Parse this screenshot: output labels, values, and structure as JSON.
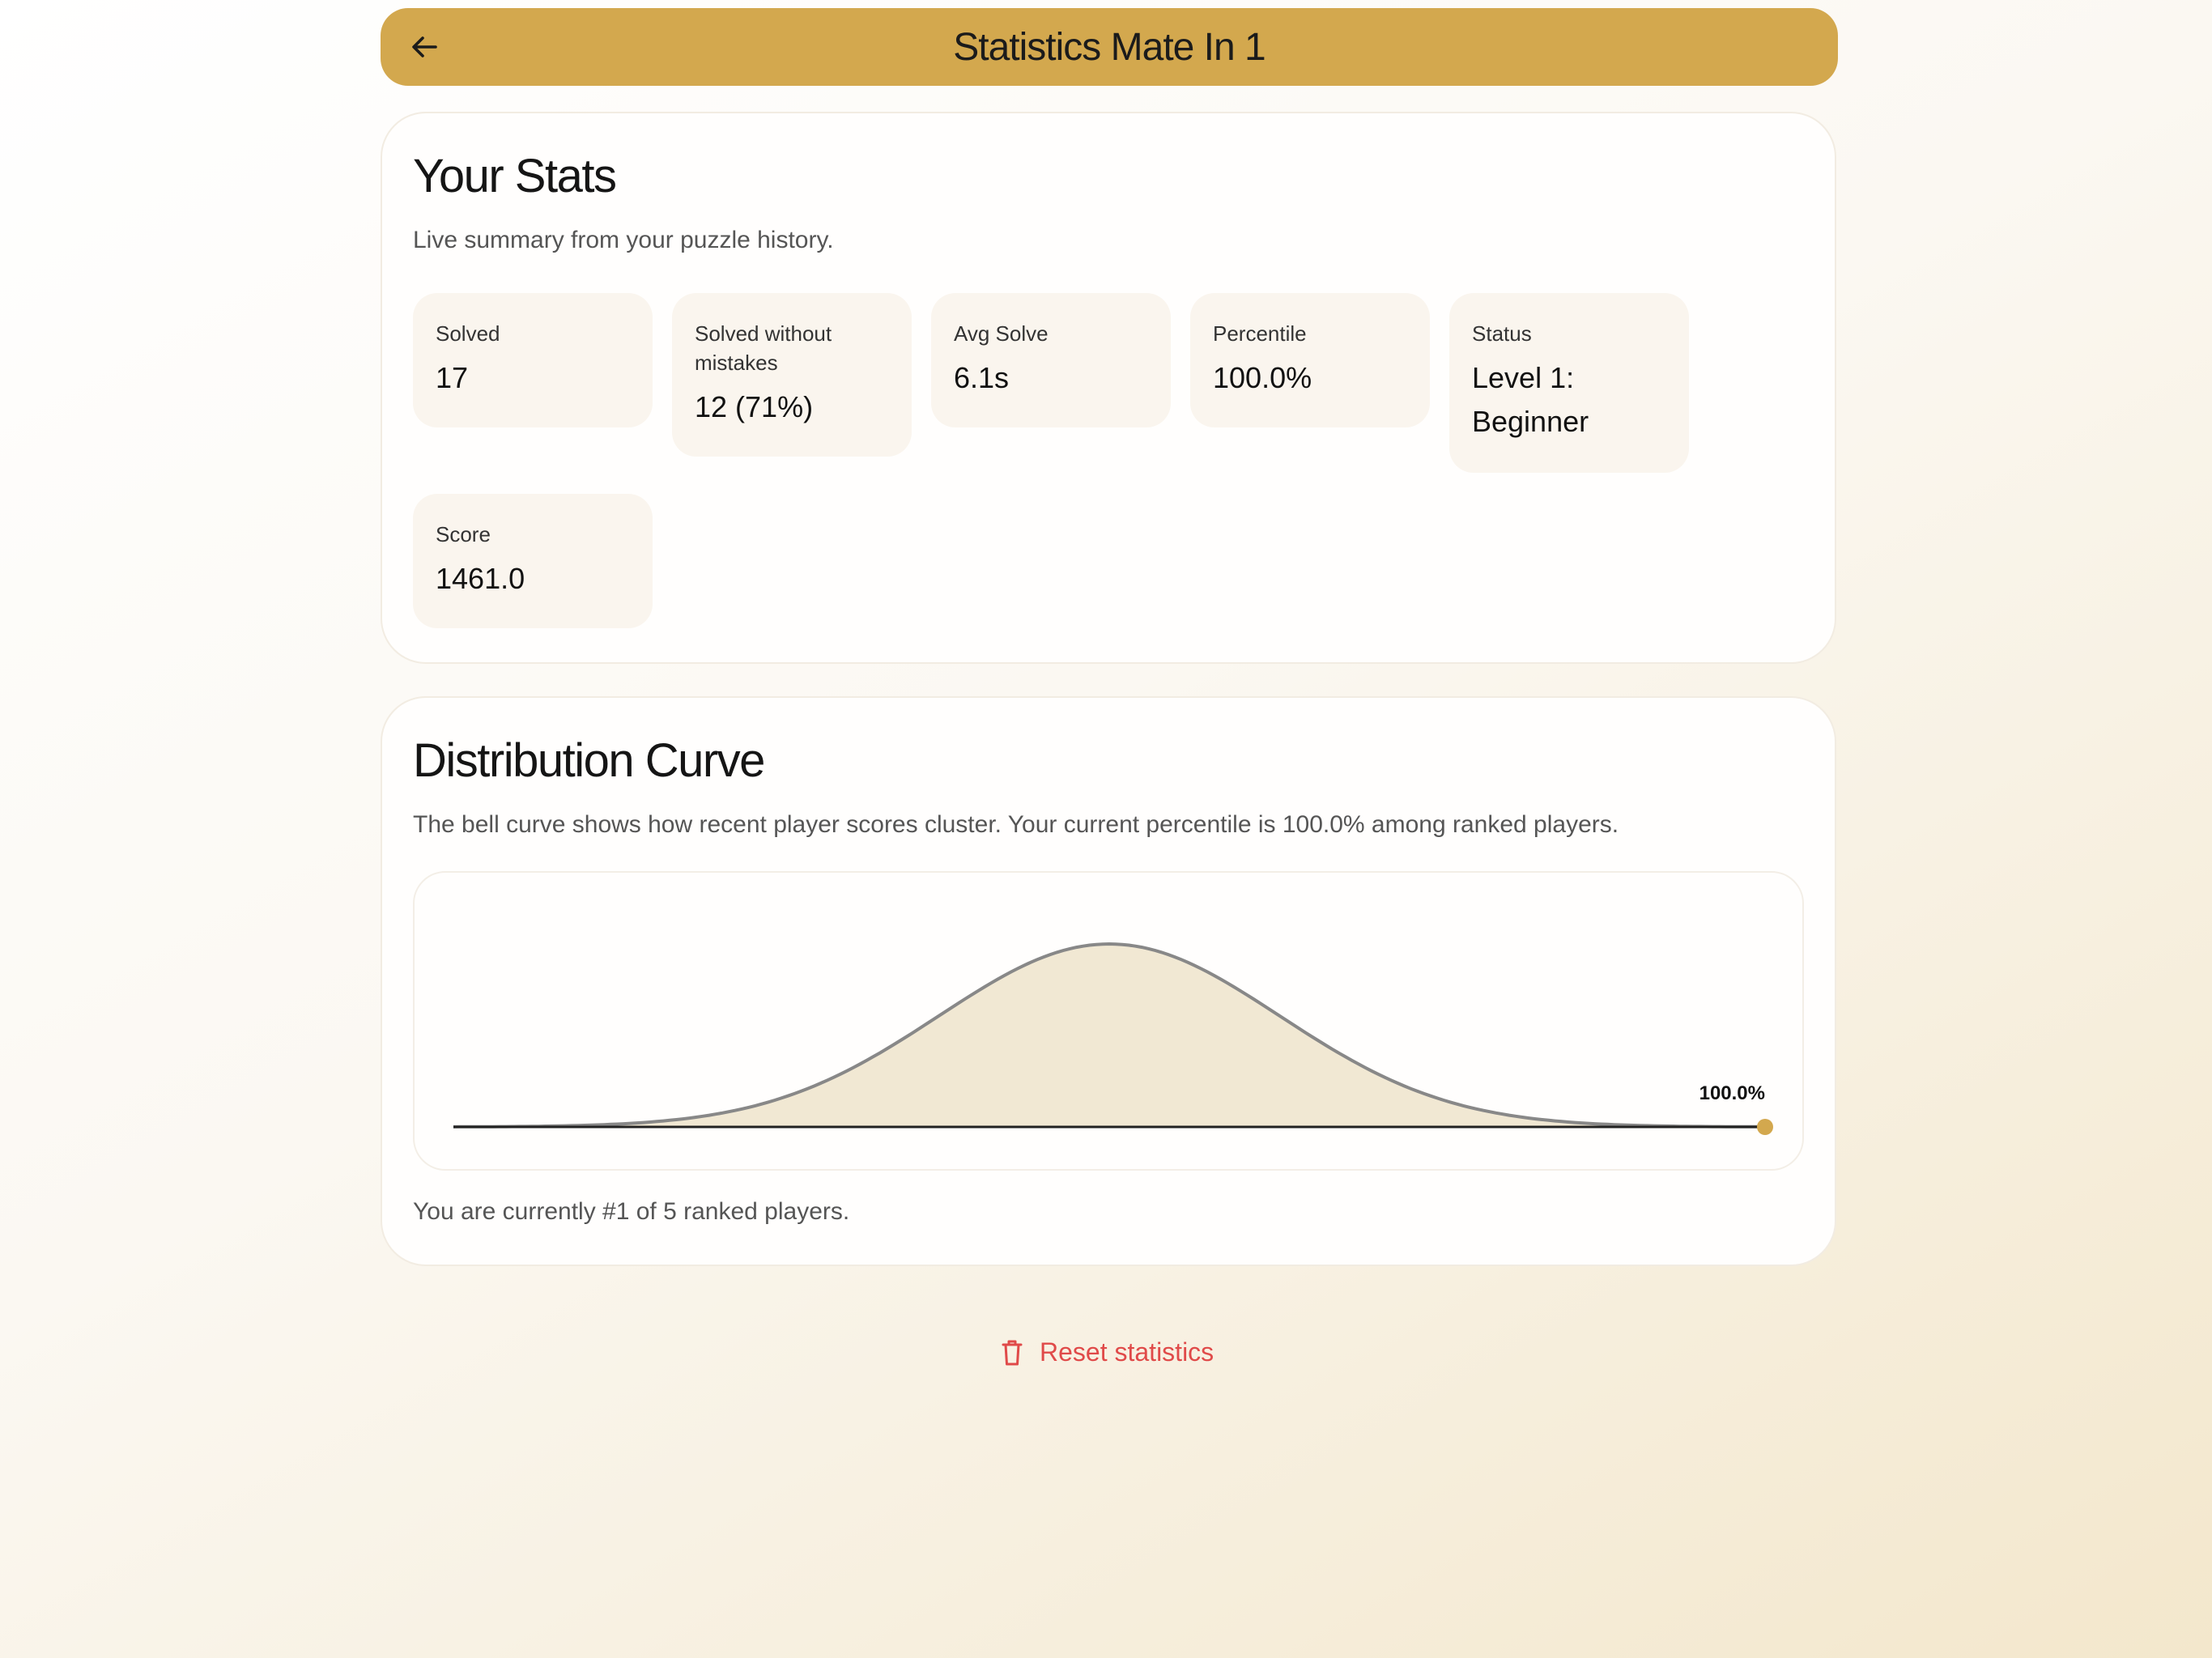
{
  "header": {
    "title": "Statistics Mate In 1",
    "back_icon": "arrow-left-icon",
    "background": "#d3a84e"
  },
  "stats_card": {
    "title": "Your Stats",
    "subtitle": "Live summary from your puzzle history.",
    "tiles": [
      {
        "label": "Solved",
        "value": "17"
      },
      {
        "label": "Solved without mistakes",
        "value": "12 (71%)"
      },
      {
        "label": "Avg Solve",
        "value": "6.1s"
      },
      {
        "label": "Percentile",
        "value": "100.0%"
      },
      {
        "label": "Status",
        "value": "Level 1: Beginner"
      },
      {
        "label": "Score",
        "value": "1461.0"
      }
    ]
  },
  "distribution_card": {
    "title": "Distribution Curve",
    "subtitle": "The bell curve shows how recent player scores cluster. Your current percentile is 100.0% among ranked players.",
    "rank_text": "You are currently #1 of 5 ranked players."
  },
  "chart_data": {
    "type": "area",
    "title": "",
    "xlabel": "",
    "ylabel": "",
    "curve": "normal",
    "x_range": [
      0,
      100
    ],
    "mean": 50,
    "stddev": 13,
    "marker": {
      "percentile": 100.0,
      "label": "100.0%"
    },
    "fill_color": "#f1e8d3",
    "line_color": "#888888",
    "marker_color": "#d3a84e",
    "grid": false
  },
  "footer": {
    "reset_label": "Reset statistics",
    "reset_icon": "trash-icon",
    "reset_color": "#e04a49"
  }
}
